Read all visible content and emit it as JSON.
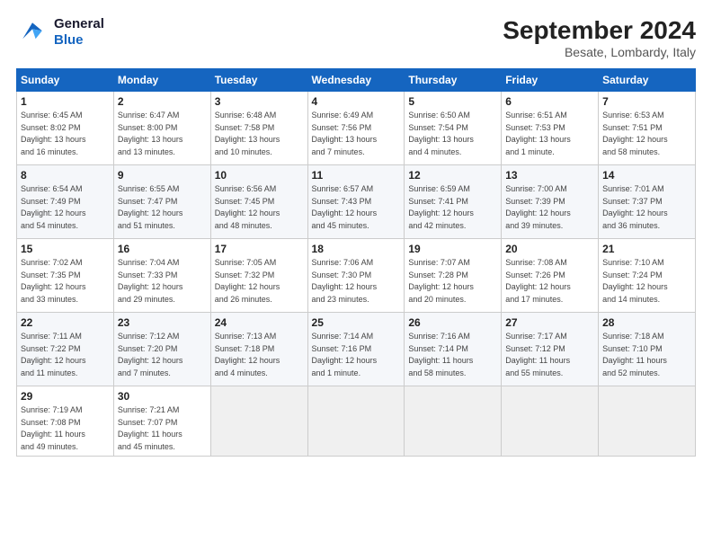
{
  "logo": {
    "line1": "General",
    "line2": "Blue"
  },
  "title": "September 2024",
  "subtitle": "Besate, Lombardy, Italy",
  "days_header": [
    "Sunday",
    "Monday",
    "Tuesday",
    "Wednesday",
    "Thursday",
    "Friday",
    "Saturday"
  ],
  "weeks": [
    [
      {
        "day": "1",
        "info": "Sunrise: 6:45 AM\nSunset: 8:02 PM\nDaylight: 13 hours\nand 16 minutes."
      },
      {
        "day": "2",
        "info": "Sunrise: 6:47 AM\nSunset: 8:00 PM\nDaylight: 13 hours\nand 13 minutes."
      },
      {
        "day": "3",
        "info": "Sunrise: 6:48 AM\nSunset: 7:58 PM\nDaylight: 13 hours\nand 10 minutes."
      },
      {
        "day": "4",
        "info": "Sunrise: 6:49 AM\nSunset: 7:56 PM\nDaylight: 13 hours\nand 7 minutes."
      },
      {
        "day": "5",
        "info": "Sunrise: 6:50 AM\nSunset: 7:54 PM\nDaylight: 13 hours\nand 4 minutes."
      },
      {
        "day": "6",
        "info": "Sunrise: 6:51 AM\nSunset: 7:53 PM\nDaylight: 13 hours\nand 1 minute."
      },
      {
        "day": "7",
        "info": "Sunrise: 6:53 AM\nSunset: 7:51 PM\nDaylight: 12 hours\nand 58 minutes."
      }
    ],
    [
      {
        "day": "8",
        "info": "Sunrise: 6:54 AM\nSunset: 7:49 PM\nDaylight: 12 hours\nand 54 minutes."
      },
      {
        "day": "9",
        "info": "Sunrise: 6:55 AM\nSunset: 7:47 PM\nDaylight: 12 hours\nand 51 minutes."
      },
      {
        "day": "10",
        "info": "Sunrise: 6:56 AM\nSunset: 7:45 PM\nDaylight: 12 hours\nand 48 minutes."
      },
      {
        "day": "11",
        "info": "Sunrise: 6:57 AM\nSunset: 7:43 PM\nDaylight: 12 hours\nand 45 minutes."
      },
      {
        "day": "12",
        "info": "Sunrise: 6:59 AM\nSunset: 7:41 PM\nDaylight: 12 hours\nand 42 minutes."
      },
      {
        "day": "13",
        "info": "Sunrise: 7:00 AM\nSunset: 7:39 PM\nDaylight: 12 hours\nand 39 minutes."
      },
      {
        "day": "14",
        "info": "Sunrise: 7:01 AM\nSunset: 7:37 PM\nDaylight: 12 hours\nand 36 minutes."
      }
    ],
    [
      {
        "day": "15",
        "info": "Sunrise: 7:02 AM\nSunset: 7:35 PM\nDaylight: 12 hours\nand 33 minutes."
      },
      {
        "day": "16",
        "info": "Sunrise: 7:04 AM\nSunset: 7:33 PM\nDaylight: 12 hours\nand 29 minutes."
      },
      {
        "day": "17",
        "info": "Sunrise: 7:05 AM\nSunset: 7:32 PM\nDaylight: 12 hours\nand 26 minutes."
      },
      {
        "day": "18",
        "info": "Sunrise: 7:06 AM\nSunset: 7:30 PM\nDaylight: 12 hours\nand 23 minutes."
      },
      {
        "day": "19",
        "info": "Sunrise: 7:07 AM\nSunset: 7:28 PM\nDaylight: 12 hours\nand 20 minutes."
      },
      {
        "day": "20",
        "info": "Sunrise: 7:08 AM\nSunset: 7:26 PM\nDaylight: 12 hours\nand 17 minutes."
      },
      {
        "day": "21",
        "info": "Sunrise: 7:10 AM\nSunset: 7:24 PM\nDaylight: 12 hours\nand 14 minutes."
      }
    ],
    [
      {
        "day": "22",
        "info": "Sunrise: 7:11 AM\nSunset: 7:22 PM\nDaylight: 12 hours\nand 11 minutes."
      },
      {
        "day": "23",
        "info": "Sunrise: 7:12 AM\nSunset: 7:20 PM\nDaylight: 12 hours\nand 7 minutes."
      },
      {
        "day": "24",
        "info": "Sunrise: 7:13 AM\nSunset: 7:18 PM\nDaylight: 12 hours\nand 4 minutes."
      },
      {
        "day": "25",
        "info": "Sunrise: 7:14 AM\nSunset: 7:16 PM\nDaylight: 12 hours\nand 1 minute."
      },
      {
        "day": "26",
        "info": "Sunrise: 7:16 AM\nSunset: 7:14 PM\nDaylight: 11 hours\nand 58 minutes."
      },
      {
        "day": "27",
        "info": "Sunrise: 7:17 AM\nSunset: 7:12 PM\nDaylight: 11 hours\nand 55 minutes."
      },
      {
        "day": "28",
        "info": "Sunrise: 7:18 AM\nSunset: 7:10 PM\nDaylight: 11 hours\nand 52 minutes."
      }
    ],
    [
      {
        "day": "29",
        "info": "Sunrise: 7:19 AM\nSunset: 7:08 PM\nDaylight: 11 hours\nand 49 minutes."
      },
      {
        "day": "30",
        "info": "Sunrise: 7:21 AM\nSunset: 7:07 PM\nDaylight: 11 hours\nand 45 minutes."
      },
      {
        "day": "",
        "info": ""
      },
      {
        "day": "",
        "info": ""
      },
      {
        "day": "",
        "info": ""
      },
      {
        "day": "",
        "info": ""
      },
      {
        "day": "",
        "info": ""
      }
    ]
  ]
}
